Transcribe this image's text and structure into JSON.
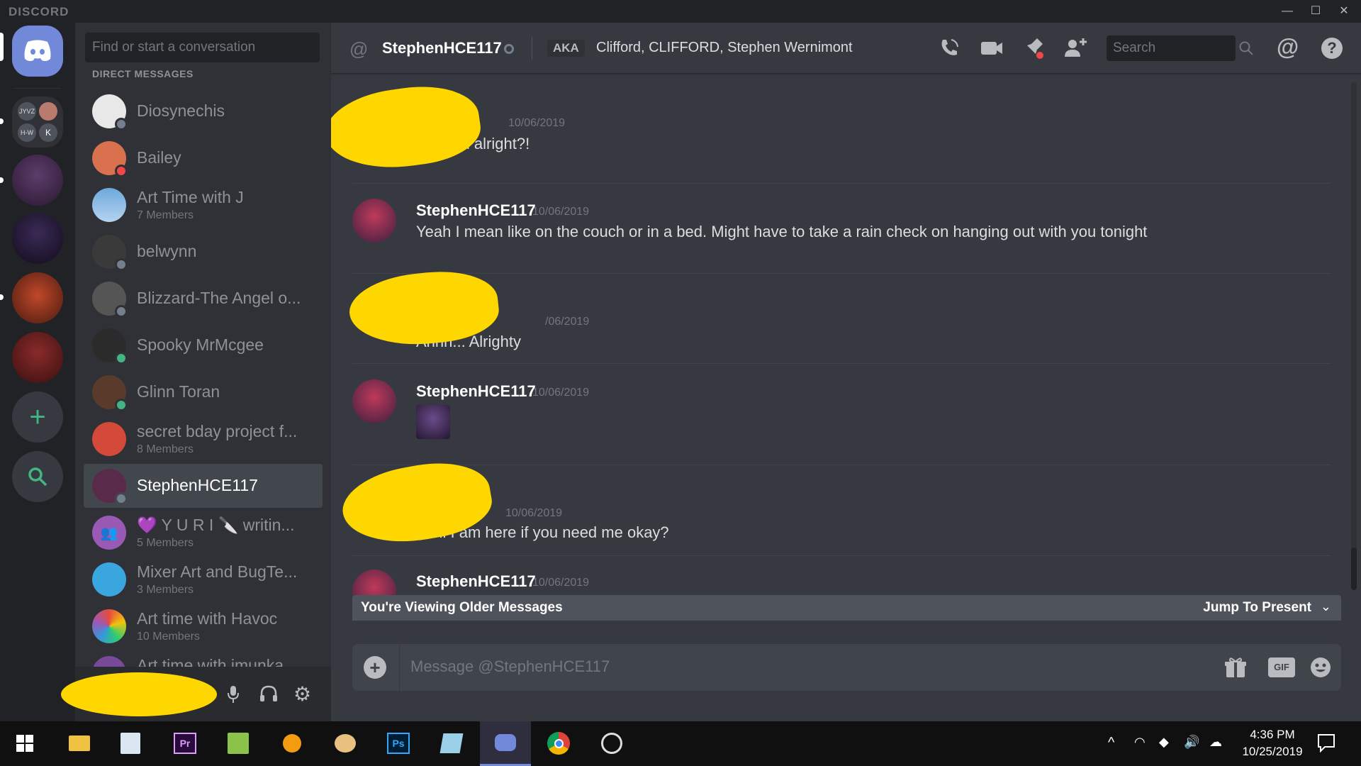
{
  "window": {
    "brand": "DISCORD",
    "controls": [
      "minimize",
      "maximize",
      "close"
    ]
  },
  "sidebar": {
    "search_placeholder": "Find or start a conversation",
    "section_label": "DIRECT MESSAGES",
    "dms": [
      {
        "name": "Diosynechis",
        "sub": "",
        "status": "offline"
      },
      {
        "name": "Bailey",
        "sub": "",
        "status": "dnd"
      },
      {
        "name": "Art Time with J",
        "sub": "7 Members",
        "status": ""
      },
      {
        "name": "belwynn",
        "sub": "",
        "status": "offline"
      },
      {
        "name": "Blizzard-The Angel o...",
        "sub": "",
        "status": "offline"
      },
      {
        "name": "Spooky MrMcgee",
        "sub": "",
        "status": "online"
      },
      {
        "name": "Glinn Toran",
        "sub": "",
        "status": "online"
      },
      {
        "name": "secret bday project f...",
        "sub": "8 Members",
        "status": ""
      },
      {
        "name": "StephenHCE117",
        "sub": "",
        "status": "offline",
        "active": true
      },
      {
        "name": "💜 Y U R I 🔪 writin...",
        "sub": "5 Members",
        "status": ""
      },
      {
        "name": "Mixer Art and BugTe...",
        "sub": "3 Members",
        "status": ""
      },
      {
        "name": "Art time with Havoc",
        "sub": "10 Members",
        "status": ""
      },
      {
        "name": "Art time with imunka",
        "sub": "",
        "status": ""
      }
    ]
  },
  "header": {
    "username": "StephenHCE117",
    "aka_label": "AKA",
    "aka_names": "Clifford, CLIFFORD, Stephen Wernimont",
    "search_placeholder": "Search"
  },
  "messages": [
    {
      "author": "",
      "time": "10/06/2019",
      "text": "Are you alright?!"
    },
    {
      "author": "StephenHCE117",
      "time": "10/06/2019",
      "text": "Yeah I mean like on the couch or in a bed. Might have to take a rain check on hanging out with you tonight"
    },
    {
      "author": "",
      "time": "/06/2019",
      "text": "Ahhh... Alrighty"
    },
    {
      "author": "StephenHCE117",
      "time": "10/06/2019",
      "text": ""
    },
    {
      "author": "",
      "time": "10/06/2019",
      "text": "Well I am here if you need me okay?"
    },
    {
      "author": "StephenHCE117",
      "time": "10/06/2019",
      "text": ""
    }
  ],
  "older_bar": {
    "left": "You're Viewing Older Messages",
    "right": "Jump To Present"
  },
  "composer": {
    "placeholder": "Message @StephenHCE117",
    "gif_label": "GIF"
  },
  "taskbar": {
    "time": "4:36 PM",
    "date": "10/25/2019"
  },
  "colors": {
    "blurple": "#7289da",
    "online": "#43b581",
    "dnd": "#f04747",
    "offline": "#747f8d",
    "censor": "#ffd700"
  }
}
